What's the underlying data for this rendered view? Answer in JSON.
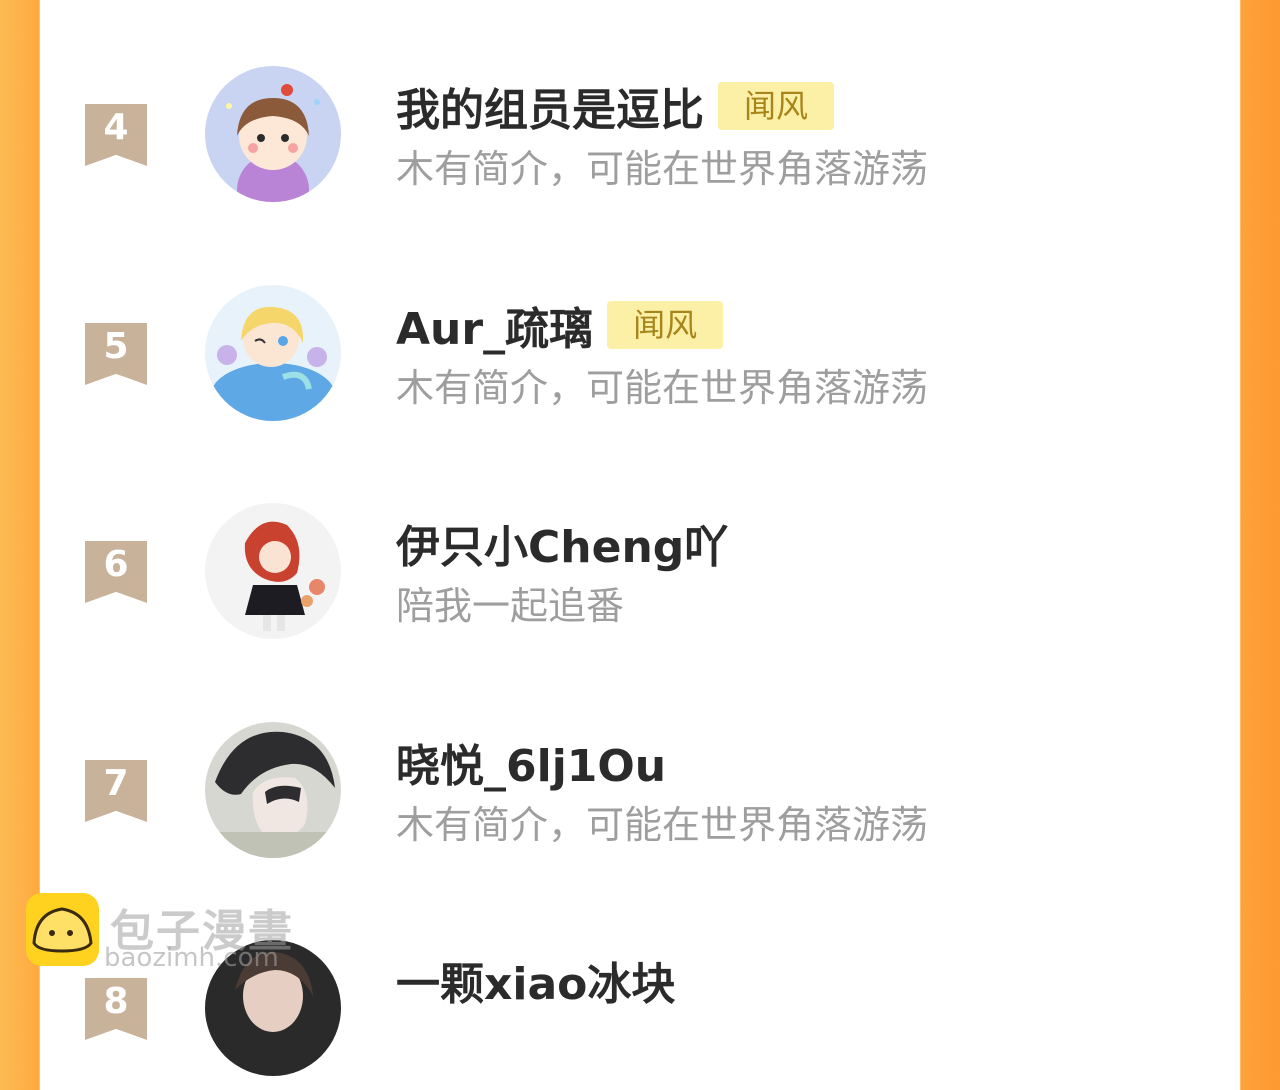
{
  "list": {
    "items": [
      {
        "rank": "4",
        "name": "我的组员是逗比",
        "badge": "闻风",
        "bio": "木有简介，可能在世界角落游荡"
      },
      {
        "rank": "5",
        "name": "Aur_疏璃",
        "badge": "闻风",
        "bio": "木有简介，可能在世界角落游荡"
      },
      {
        "rank": "6",
        "name": "伊只小Cheng吖",
        "bio": "陪我一起追番"
      },
      {
        "rank": "7",
        "name": "晓悦_6lj1Ou",
        "bio": "木有简介，可能在世界角落游荡"
      },
      {
        "rank": "8",
        "name": "一颗xiao冰块"
      }
    ]
  },
  "watermark": {
    "title": "包子漫畫",
    "url": "baozimh.com"
  },
  "colors": {
    "side_border": "#fea93e",
    "rank_ribbon": "#c8b29a",
    "badge_bg": "#fcefa6",
    "badge_text": "#a8851a",
    "name_text": "#2b2b2b",
    "bio_text": "#9e9e9e"
  }
}
